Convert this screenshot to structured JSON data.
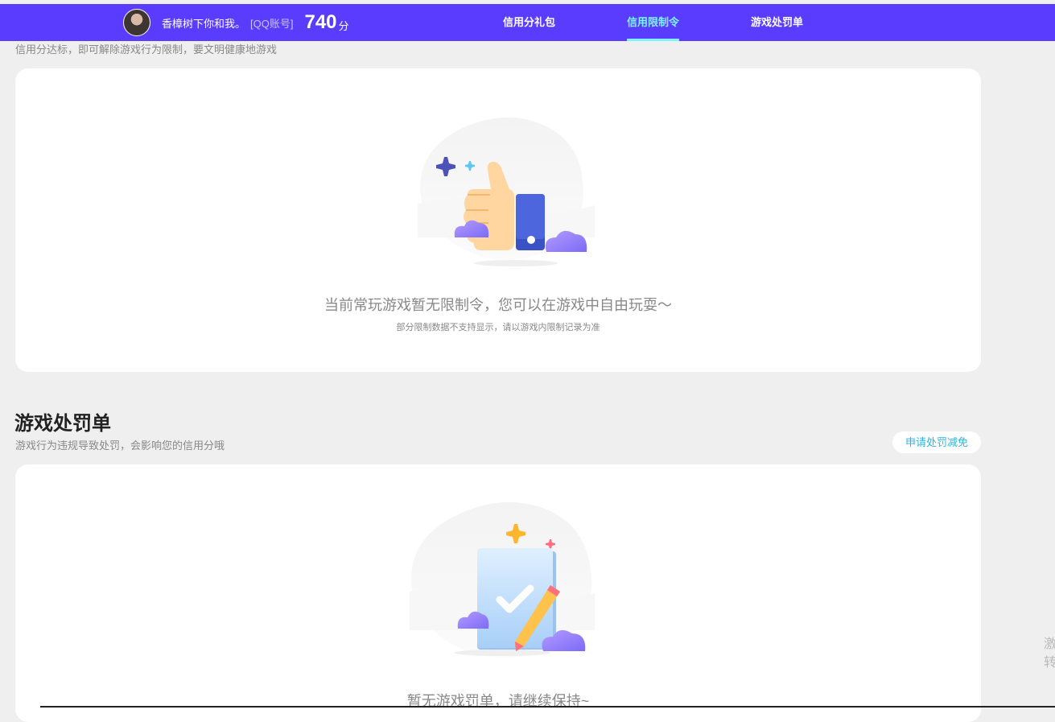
{
  "header": {
    "username": "香樟树下你和我。",
    "account_label": "[QQ账号]",
    "score": "740",
    "score_unit": "分",
    "tabs": [
      {
        "label": "信用分礼包",
        "active": false
      },
      {
        "label": "信用限制令",
        "active": true
      },
      {
        "label": "游戏处罚单",
        "active": false
      }
    ],
    "colors": {
      "bar": "#5a3cff",
      "active_tab": "#7df3ff"
    }
  },
  "restriction": {
    "description": "信用分达标，即可解除游戏行为限制，要文明健康地游戏",
    "empty_title": "当前常玩游戏暂无限制令，您可以在游戏中自由玩耍～",
    "empty_note": "部分限制数据不支持显示，请以游戏内限制记录为准",
    "illustration": "thumbs-up-icon"
  },
  "penalty": {
    "title": "游戏处罚单",
    "description": "游戏行为违规导致处罚，会影响您的信用分哦",
    "appeal_button": "申请处罚减免",
    "empty_title": "暂无游戏罚单，请继续保持~",
    "illustration": "clipboard-check-icon"
  },
  "side_text": [
    "激",
    "转"
  ]
}
